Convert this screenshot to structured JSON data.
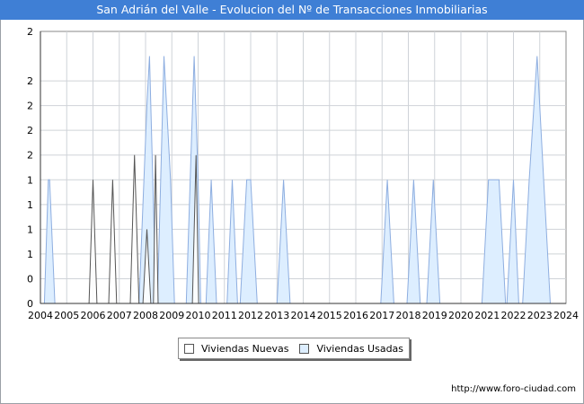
{
  "chart_data": {
    "type": "area",
    "title": "San Adrián del Valle - Evolucion del Nº de Transacciones Inmobiliarias",
    "xlabel": "",
    "ylabel": "",
    "x_tick_labels": [
      "2004",
      "2005",
      "2006",
      "2007",
      "2008",
      "2009",
      "2010",
      "2011",
      "2012",
      "2013",
      "2014",
      "2015",
      "2016",
      "2017",
      "2018",
      "2019",
      "2020",
      "2021",
      "2022",
      "2023",
      "2024"
    ],
    "y_tick_labels": [
      "0",
      "0",
      "1",
      "1",
      "1",
      "1",
      "2",
      "2",
      "2",
      "2"
    ],
    "xlim": [
      2004.0,
      2024.0
    ],
    "ylim": [
      0,
      2.2
    ],
    "grid": true,
    "legend_position": "bottom",
    "series": [
      {
        "name": "Viviendas Nuevas",
        "color_fill": "#ffffff",
        "color_line": "#555555",
        "points": [
          [
            2005.85,
            0
          ],
          [
            2006.0,
            1.0
          ],
          [
            2006.15,
            0
          ],
          [
            2006.6,
            0
          ],
          [
            2006.75,
            1.0
          ],
          [
            2006.9,
            0
          ],
          [
            2007.42,
            0
          ],
          [
            2007.58,
            1.2
          ],
          [
            2007.75,
            0
          ],
          [
            2007.9,
            0
          ],
          [
            2008.05,
            0.6
          ],
          [
            2008.2,
            0
          ],
          [
            2008.3,
            0
          ],
          [
            2008.38,
            1.2
          ],
          [
            2008.48,
            0
          ],
          [
            2009.78,
            0
          ],
          [
            2009.92,
            1.2
          ],
          [
            2010.02,
            0
          ]
        ]
      },
      {
        "name": "Viviendas Usadas",
        "color_fill": "#ddeeff",
        "color_line": "#8eaee0",
        "points": [
          [
            2004.15,
            0
          ],
          [
            2004.3,
            1.0
          ],
          [
            2004.35,
            1.0
          ],
          [
            2004.55,
            0
          ],
          [
            2007.75,
            0
          ],
          [
            2008.05,
            1.6
          ],
          [
            2008.15,
            2.0
          ],
          [
            2008.4,
            0
          ],
          [
            2008.45,
            0
          ],
          [
            2008.7,
            2.0
          ],
          [
            2008.95,
            1.0
          ],
          [
            2009.1,
            0
          ],
          [
            2009.55,
            0
          ],
          [
            2009.7,
            1.0
          ],
          [
            2009.85,
            2.0
          ],
          [
            2010.0,
            1.0
          ],
          [
            2010.1,
            0
          ],
          [
            2010.3,
            0
          ],
          [
            2010.5,
            1.0
          ],
          [
            2010.7,
            0
          ],
          [
            2011.1,
            0
          ],
          [
            2011.3,
            1.0
          ],
          [
            2011.5,
            0
          ],
          [
            2011.6,
            0
          ],
          [
            2011.85,
            1.0
          ],
          [
            2012.0,
            1.0
          ],
          [
            2012.25,
            0
          ],
          [
            2013.0,
            0
          ],
          [
            2013.25,
            1.0
          ],
          [
            2013.5,
            0
          ],
          [
            2016.95,
            0
          ],
          [
            2017.2,
            1.0
          ],
          [
            2017.45,
            0
          ],
          [
            2017.95,
            0
          ],
          [
            2018.2,
            1.0
          ],
          [
            2018.45,
            0
          ],
          [
            2018.7,
            0
          ],
          [
            2018.95,
            1.0
          ],
          [
            2019.2,
            0
          ],
          [
            2020.8,
            0
          ],
          [
            2021.05,
            1.0
          ],
          [
            2021.45,
            1.0
          ],
          [
            2021.7,
            0
          ],
          [
            2021.75,
            0
          ],
          [
            2022.0,
            1.0
          ],
          [
            2022.2,
            0
          ],
          [
            2022.35,
            0
          ],
          [
            2022.6,
            1.0
          ],
          [
            2022.9,
            2.0
          ],
          [
            2023.15,
            1.0
          ],
          [
            2023.4,
            0
          ]
        ]
      }
    ]
  },
  "legend": {
    "items": [
      {
        "label": "Viviendas Nuevas",
        "color": "#ffffff"
      },
      {
        "label": "Viviendas Usadas",
        "color": "#ddeeff"
      }
    ]
  },
  "footer": {
    "url": "http://www.foro-ciudad.com"
  },
  "colors": {
    "title_bar": "#3f7fd5",
    "grid": "#cfd3d8",
    "axis": "#333333"
  }
}
